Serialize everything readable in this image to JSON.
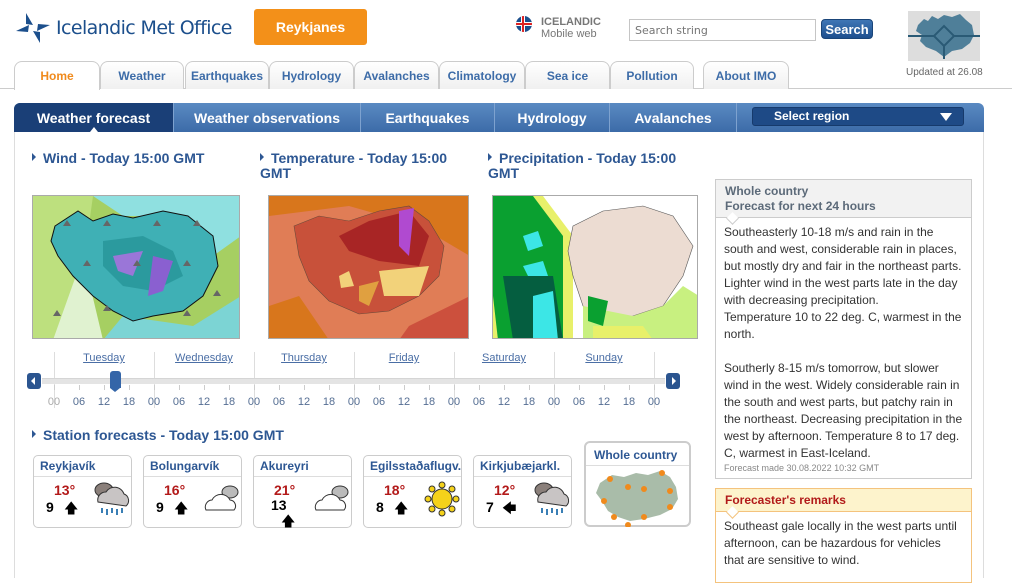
{
  "header": {
    "logo_text": "Icelandic Met Office",
    "featured_button": "Reykjanes",
    "language": {
      "line1": "ICELANDIC",
      "line2": "Mobile web"
    },
    "search": {
      "placeholder": "Search string",
      "button": "Search"
    },
    "map_updated": "Updated at 26.08"
  },
  "top_tabs": [
    {
      "label": "Home",
      "active": true
    },
    {
      "label": "Weather"
    },
    {
      "label": "Earthquakes"
    },
    {
      "label": "Hydrology"
    },
    {
      "label": "Avalanches"
    },
    {
      "label": "Climatology"
    },
    {
      "label": "Sea ice"
    },
    {
      "label": "Pollution"
    },
    {
      "label": "About IMO"
    }
  ],
  "sub_nav": {
    "items": [
      {
        "label": "Weather forecast",
        "active": true
      },
      {
        "label": "Weather observations"
      },
      {
        "label": "Earthquakes"
      },
      {
        "label": "Hydrology"
      },
      {
        "label": "Avalanches"
      }
    ],
    "select_region": "Select region"
  },
  "maps": [
    {
      "title": "Wind - Today 15:00 GMT"
    },
    {
      "title": "Temperature - Today 15:00 GMT"
    },
    {
      "title": "Precipitation - Today 15:00 GMT"
    }
  ],
  "timeline": {
    "days": [
      "Tuesday",
      "Wednesday",
      "Thursday",
      "Friday",
      "Saturday",
      "Sunday"
    ],
    "hours": [
      "00",
      "06",
      "12",
      "18",
      "00",
      "06",
      "12",
      "18",
      "00",
      "06",
      "12",
      "18",
      "00",
      "06",
      "12",
      "18",
      "00",
      "06",
      "12",
      "18",
      "00",
      "06",
      "12",
      "18",
      "00"
    ],
    "selected_time": "Tuesday 15:00"
  },
  "stations": {
    "title": "Station forecasts - Today 15:00 GMT",
    "items": [
      {
        "name": "Reykjavík",
        "temp": "13°",
        "wind": "9",
        "wind_dir": "up",
        "weather": "rain-cloud-icon"
      },
      {
        "name": "Bolungarvík",
        "temp": "16°",
        "wind": "9",
        "wind_dir": "up",
        "weather": "cloudy-icon"
      },
      {
        "name": "Akureyri",
        "temp": "21°",
        "wind": "13",
        "wind_dir": "up",
        "weather": "cloudy-icon"
      },
      {
        "name": "Egilsstaðaflugv.",
        "temp": "18°",
        "wind": "8",
        "wind_dir": "up",
        "weather": "sun-icon"
      },
      {
        "name": "Kirkjubæjarkl.",
        "temp": "12°",
        "wind": "7",
        "wind_dir": "left",
        "weather": "rain-cloud-icon"
      }
    ],
    "whole_country": "Whole country"
  },
  "forecast": {
    "title_line1": "Whole country",
    "title_line2": "Forecast for next 24 hours",
    "paragraph1": "Southeasterly 10-18 m/s and rain in the south and west, considerable rain in places, but mostly dry and fair in the northeast parts. Lighter wind in the west parts late in the day with decreasing precipitation.",
    "paragraph1b": "Temperature 10 to 22 deg. C, warmest in the north.",
    "paragraph2": "Southerly 8-15 m/s tomorrow, but slower wind in the west. Widely considerable rain in the south and west parts, but patchy rain in the northeast. Decreasing precipitation in the west by afternoon. Temperature 8 to 17 deg. C, warmest in East-Iceland.",
    "made": "Forecast made 30.08.2022 10:32 GMT"
  },
  "remarks": {
    "title": "Forecaster's remarks",
    "text": "Southeast gale locally in the west parts until afternoon, can be hazardous for vehicles that are sensitive to wind."
  },
  "colors": {
    "brand_blue": "#1c4f8c",
    "accent_orange": "#f39019",
    "temp_red": "#b31a1a"
  }
}
